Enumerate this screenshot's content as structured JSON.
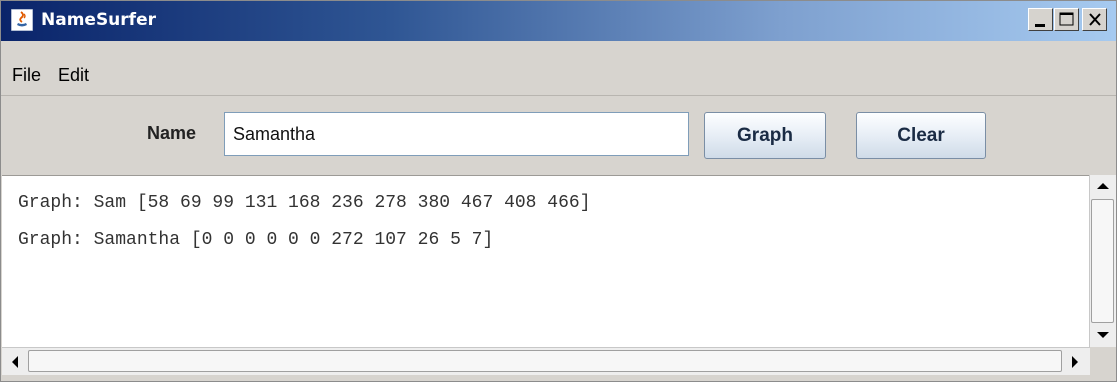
{
  "window": {
    "title": "NameSurfer",
    "controls": {
      "minimize": "minimize-icon",
      "maximize": "maximize-icon",
      "close": "close-icon"
    }
  },
  "menu": {
    "items": [
      {
        "label": "File"
      },
      {
        "label": "Edit"
      }
    ]
  },
  "form": {
    "name_label": "Name",
    "name_value": "Samantha",
    "graph_label": "Graph",
    "clear_label": "Clear"
  },
  "output": {
    "lines": [
      "Graph: Sam [58 69 99 131 168 236 278 380 467 408 466]",
      "Graph: Samantha [0 0 0 0 0 0 272 107 26 5 7]"
    ]
  },
  "colors": {
    "title_bar_start": "#0a246a",
    "title_bar_end": "#a6caf0",
    "window_bg": "#d7d4cf"
  }
}
